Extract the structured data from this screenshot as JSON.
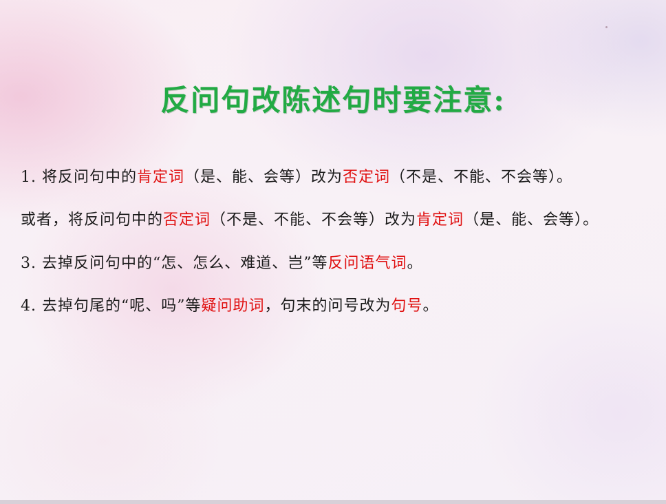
{
  "title": "反问句改陈述句时要注意:",
  "colors": {
    "title": "#22aa44",
    "highlight": "#e01010",
    "text": "#1a1a1a"
  },
  "items": [
    {
      "parts": [
        "1. 将反问句中的",
        "肯定词",
        "（是、能、会等）改为",
        "否定词",
        "（不是、不能、不会等）。"
      ]
    },
    {
      "parts": [
        "或者，将反问句中的",
        "否定词",
        "（不是、不能、不会等）改为",
        "肯定词",
        "（是、能、会等）。"
      ]
    },
    {
      "parts": [
        "3. 去掉反问句中的“怎、怎么、难道、岂”等",
        "反问语气词",
        "。"
      ]
    },
    {
      "parts": [
        "4. 去掉句尾的“呢、吗”等",
        "疑问助词",
        "，句末的问号改为",
        "句号",
        "。"
      ]
    }
  ]
}
